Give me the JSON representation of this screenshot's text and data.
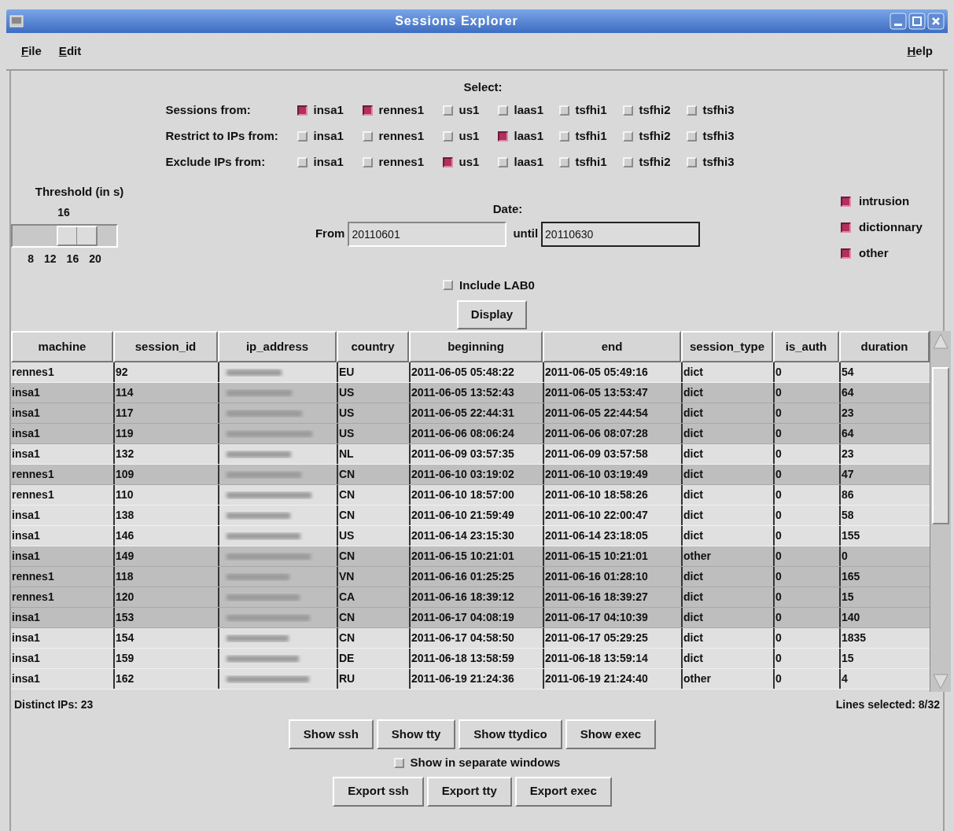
{
  "window": {
    "title": "Sessions Explorer"
  },
  "menu": {
    "left": [
      {
        "label": "File"
      },
      {
        "label": "Edit"
      }
    ],
    "right": [
      {
        "label": "Help"
      }
    ]
  },
  "select": {
    "title": "Select:",
    "groups": [
      {
        "label": "Sessions from:",
        "options": [
          {
            "label": "insa1",
            "checked": true
          },
          {
            "label": "rennes1",
            "checked": true
          },
          {
            "label": "us1",
            "checked": false
          },
          {
            "label": "laas1",
            "checked": false
          },
          {
            "label": "tsfhi1",
            "checked": false
          },
          {
            "label": "tsfhi2",
            "checked": false
          },
          {
            "label": "tsfhi3",
            "checked": false
          }
        ]
      },
      {
        "label": "Restrict to IPs from:",
        "options": [
          {
            "label": "insa1",
            "checked": false
          },
          {
            "label": "rennes1",
            "checked": false
          },
          {
            "label": "us1",
            "checked": false
          },
          {
            "label": "laas1",
            "checked": true
          },
          {
            "label": "tsfhi1",
            "checked": false
          },
          {
            "label": "tsfhi2",
            "checked": false
          },
          {
            "label": "tsfhi3",
            "checked": false
          }
        ]
      },
      {
        "label": "Exclude IPs from:",
        "options": [
          {
            "label": "insa1",
            "checked": false
          },
          {
            "label": "rennes1",
            "checked": false
          },
          {
            "label": "us1",
            "checked": true
          },
          {
            "label": "laas1",
            "checked": false
          },
          {
            "label": "tsfhi1",
            "checked": false
          },
          {
            "label": "tsfhi2",
            "checked": false
          },
          {
            "label": "tsfhi3",
            "checked": false
          }
        ]
      }
    ]
  },
  "threshold": {
    "label": "Threshold (in s)",
    "reading": "16",
    "ticks": [
      "8",
      "12",
      "16",
      "20"
    ]
  },
  "date": {
    "title": "Date:",
    "fields": [
      {
        "label": "From",
        "value": "20110601",
        "focused": false
      },
      {
        "label": "until",
        "value": "20110630",
        "focused": true
      }
    ]
  },
  "types": [
    {
      "label": "intrusion",
      "checked": true
    },
    {
      "label": "dictionnary",
      "checked": true
    },
    {
      "label": "other",
      "checked": true
    }
  ],
  "include_lab0": {
    "label": "Include LAB0",
    "checked": false
  },
  "display_button": "Display",
  "table": {
    "columns": [
      "machine",
      "session_id",
      "ip_address",
      "country",
      "beginning",
      "end",
      "session_type",
      "is_auth",
      "duration"
    ],
    "rows": [
      {
        "selected": false,
        "cells": [
          "rennes1",
          "92",
          null,
          "EU",
          "2011-06-05 05:48:22",
          "2011-06-05 05:49:16",
          "dict",
          "0",
          "54"
        ]
      },
      {
        "selected": true,
        "cells": [
          "insa1",
          "114",
          null,
          "US",
          "2011-06-05 13:52:43",
          "2011-06-05 13:53:47",
          "dict",
          "0",
          "64"
        ]
      },
      {
        "selected": true,
        "cells": [
          "insa1",
          "117",
          null,
          "US",
          "2011-06-05 22:44:31",
          "2011-06-05 22:44:54",
          "dict",
          "0",
          "23"
        ]
      },
      {
        "selected": true,
        "cells": [
          "insa1",
          "119",
          null,
          "US",
          "2011-06-06 08:06:24",
          "2011-06-06 08:07:28",
          "dict",
          "0",
          "64"
        ]
      },
      {
        "selected": false,
        "cells": [
          "insa1",
          "132",
          null,
          "NL",
          "2011-06-09 03:57:35",
          "2011-06-09 03:57:58",
          "dict",
          "0",
          "23"
        ]
      },
      {
        "selected": true,
        "cells": [
          "rennes1",
          "109",
          null,
          "CN",
          "2011-06-10 03:19:02",
          "2011-06-10 03:19:49",
          "dict",
          "0",
          "47"
        ]
      },
      {
        "selected": false,
        "cells": [
          "rennes1",
          "110",
          null,
          "CN",
          "2011-06-10 18:57:00",
          "2011-06-10 18:58:26",
          "dict",
          "0",
          "86"
        ]
      },
      {
        "selected": false,
        "cells": [
          "insa1",
          "138",
          null,
          "CN",
          "2011-06-10 21:59:49",
          "2011-06-10 22:00:47",
          "dict",
          "0",
          "58"
        ]
      },
      {
        "selected": false,
        "cells": [
          "insa1",
          "146",
          null,
          "US",
          "2011-06-14 23:15:30",
          "2011-06-14 23:18:05",
          "dict",
          "0",
          "155"
        ]
      },
      {
        "selected": true,
        "cells": [
          "insa1",
          "149",
          null,
          "CN",
          "2011-06-15 10:21:01",
          "2011-06-15 10:21:01",
          "other",
          "0",
          "0"
        ]
      },
      {
        "selected": true,
        "cells": [
          "rennes1",
          "118",
          null,
          "VN",
          "2011-06-16 01:25:25",
          "2011-06-16 01:28:10",
          "dict",
          "0",
          "165"
        ]
      },
      {
        "selected": true,
        "cells": [
          "rennes1",
          "120",
          null,
          "CA",
          "2011-06-16 18:39:12",
          "2011-06-16 18:39:27",
          "dict",
          "0",
          "15"
        ]
      },
      {
        "selected": true,
        "cells": [
          "insa1",
          "153",
          null,
          "CN",
          "2011-06-17 04:08:19",
          "2011-06-17 04:10:39",
          "dict",
          "0",
          "140"
        ]
      },
      {
        "selected": false,
        "cells": [
          "insa1",
          "154",
          null,
          "CN",
          "2011-06-17 04:58:50",
          "2011-06-17 05:29:25",
          "dict",
          "0",
          "1835"
        ]
      },
      {
        "selected": false,
        "cells": [
          "insa1",
          "159",
          null,
          "DE",
          "2011-06-18 13:58:59",
          "2011-06-18 13:59:14",
          "dict",
          "0",
          "15"
        ]
      },
      {
        "selected": false,
        "cells": [
          "insa1",
          "162",
          null,
          "RU",
          "2011-06-19 21:24:36",
          "2011-06-19 21:24:40",
          "other",
          "0",
          "4"
        ]
      }
    ]
  },
  "status": {
    "left": "Distinct IPs: 23",
    "right": "Lines selected: 8/32"
  },
  "show_buttons": [
    "Show ssh",
    "Show tty",
    "Show ttydico",
    "Show exec"
  ],
  "separate_windows": {
    "label": "Show in separate windows",
    "checked": false
  },
  "export_buttons": [
    "Export ssh",
    "Export tty",
    "Export exec"
  ]
}
